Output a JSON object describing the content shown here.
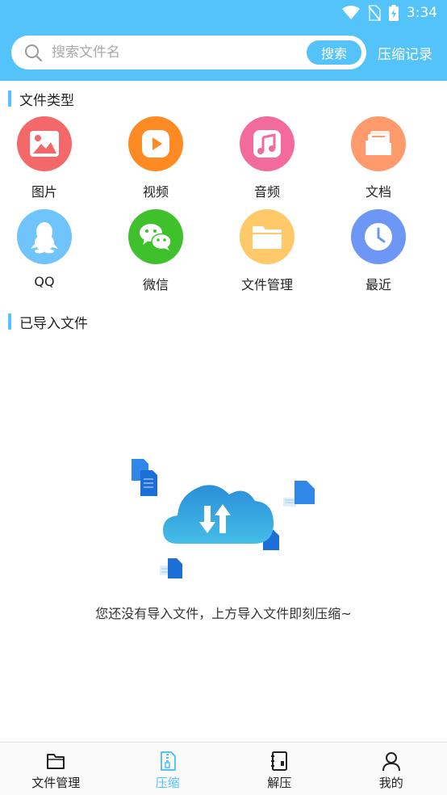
{
  "status_bar": {
    "time": "3:34",
    "icons": [
      "wifi-icon",
      "no-sim-icon",
      "battery-charging-icon"
    ]
  },
  "search": {
    "placeholder": "搜索文件名",
    "value": "",
    "button_label": "搜索",
    "history_label": "压缩记录"
  },
  "file_types": {
    "title": "文件类型",
    "items": [
      {
        "label": "图片",
        "icon": "image-icon",
        "color": "#f4686a"
      },
      {
        "label": "视频",
        "icon": "video-play-icon",
        "color": "#fd8a23"
      },
      {
        "label": "音频",
        "icon": "music-icon",
        "color": "#f26b9b"
      },
      {
        "label": "文档",
        "icon": "document-icon",
        "color": "#fe9a6b"
      },
      {
        "label": "QQ",
        "icon": "qq-icon",
        "color": "#6fc4fb"
      },
      {
        "label": "微信",
        "icon": "wechat-icon",
        "color": "#3fc12b"
      },
      {
        "label": "文件管理",
        "icon": "folder-icon",
        "color": "#ffc869"
      },
      {
        "label": "最近",
        "icon": "clock-icon",
        "color": "#6e97f5"
      }
    ]
  },
  "imported": {
    "title": "已导入文件",
    "empty_message": "您还没有导入文件，上方导入文件即刻压缩~"
  },
  "bottom_nav": {
    "items": [
      {
        "label": "文件管理",
        "icon": "folder-outline-icon",
        "active": false
      },
      {
        "label": "压缩",
        "icon": "zip-file-icon",
        "active": true
      },
      {
        "label": "解压",
        "icon": "unzip-book-icon",
        "active": false
      },
      {
        "label": "我的",
        "icon": "user-icon",
        "active": false
      }
    ],
    "active_color": "#54c3fa"
  },
  "colors": {
    "accent": "#54c3fa"
  }
}
